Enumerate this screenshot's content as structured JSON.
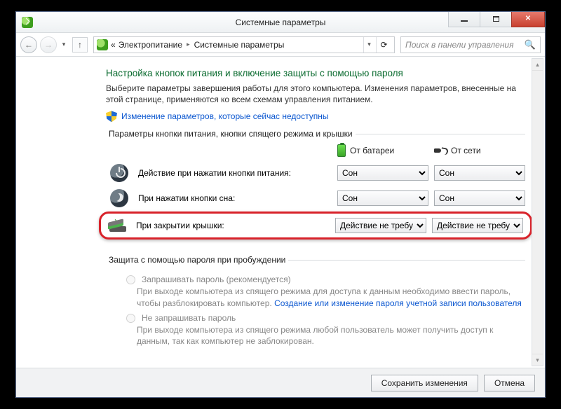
{
  "window": {
    "title": "Системные параметры"
  },
  "nav": {
    "breadcrumb": [
      "Электропитание",
      "Системные параметры"
    ],
    "search_placeholder": "Поиск в панели управления"
  },
  "page": {
    "heading": "Настройка кнопок питания и включение защиты с помощью пароля",
    "description": "Выберите параметры завершения работы для этого компьютера. Изменения параметров, внесенные на этой странице, применяются ко всем схемам управления питанием.",
    "change_link": "Изменение параметров, которые сейчас недоступны"
  },
  "group_power": {
    "legend": "Параметры кнопки питания, кнопки спящего режима и крышки",
    "col_battery": "От батареи",
    "col_ac": "От сети",
    "rows": [
      {
        "label": "Действие при нажатии кнопки питания:",
        "battery_value": "Сон",
        "ac_value": "Сон"
      },
      {
        "label": "При нажатии кнопки сна:",
        "battery_value": "Сон",
        "ac_value": "Сон"
      },
      {
        "label": "При закрытии крышки:",
        "battery_value": "Действие не требуется",
        "ac_value": "Действие не требуется"
      }
    ],
    "options_sleep": [
      "Сон"
    ],
    "options_lid": [
      "Действие не требуется"
    ]
  },
  "group_password": {
    "legend": "Защита с помощью пароля при пробуждении",
    "opt1_label": "Запрашивать пароль (рекомендуется)",
    "opt1_desc_a": "При выходе компьютера из спящего режима для доступа к данным необходимо ввести пароль, чтобы разблокировать компьютер. ",
    "opt1_link": "Создание или изменение пароля учетной записи пользователя",
    "opt2_label": "Не запрашивать пароль",
    "opt2_desc": "При выходе компьютера из спящего режима любой пользователь может получить доступ к данным, так как компьютер не заблокирован."
  },
  "footer": {
    "save": "Сохранить изменения",
    "cancel": "Отмена"
  }
}
